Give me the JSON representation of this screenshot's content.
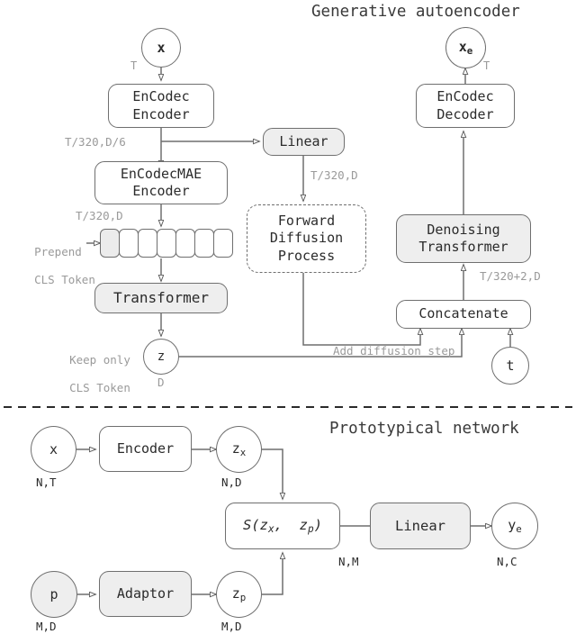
{
  "figure": {
    "sections": [
      {
        "id": "generative-autoencoder",
        "title": "Generative autoencoder"
      },
      {
        "id": "prototypical-network",
        "title": "Prototypical network"
      }
    ]
  },
  "generative": {
    "nodes": {
      "input_x": "x",
      "encodec_encoder": {
        "line1": "EnCodec",
        "line2": "Encoder"
      },
      "linear": "Linear",
      "encodecmae_encoder": {
        "line1": "EnCodecMAE",
        "line2": "Encoder"
      },
      "transformer": "Transformer",
      "latent_z": "z",
      "forward_diffusion": {
        "line1": "Forward",
        "line2": "Diffusion",
        "line3": "Process"
      },
      "denoising_transformer": {
        "line1": "Denoising",
        "line2": "Transformer"
      },
      "concatenate": "Concatenate",
      "timestep_t": "t",
      "encodec_decoder": {
        "line1": "EnCodec",
        "line2": "Decoder"
      },
      "output_xe": "x",
      "output_xe_sub": "e"
    },
    "edge_labels": {
      "x_to_encoder": "T",
      "encoder_out": "T/320,D/6",
      "linear_out": "T/320,D",
      "encodecmae_out": "T/320,D",
      "z_dim": "D",
      "concat_out": "T/320+2,D",
      "decoder_to_xe": "T"
    },
    "annotations": {
      "prepend_cls": {
        "line1": "Prepend",
        "line2": "CLS Token"
      },
      "keep_cls": {
        "line1": "Keep only",
        "line2": "CLS Token"
      },
      "add_diffusion_step": "Add diffusion step"
    },
    "token_row": {
      "count": 7,
      "cls_index": 0
    }
  },
  "prototypical": {
    "nodes": {
      "input_x": "x",
      "encoder": "Encoder",
      "zx": "z",
      "zx_sub": "x",
      "similarity": "S(z",
      "similarity_sub1": "x",
      "similarity_mid": ",  z",
      "similarity_sub2": "p",
      "similarity_end": ")",
      "linear": "Linear",
      "ye": "y",
      "ye_sub": "e",
      "input_p": "p",
      "adaptor": "Adaptor",
      "zp": "z",
      "zp_sub": "p"
    },
    "edge_labels": {
      "x_dim": "N,T",
      "zx_dim": "N,D",
      "similarity_dim": "N,M",
      "ye_dim": "N,C",
      "p_dim": "M,D",
      "zp_dim": "M,D"
    }
  },
  "colors": {
    "stroke": "#6f6f6f",
    "fill_gray": "#eeeeee",
    "label_gray": "#9a9a9a",
    "text": "#2b2b2b",
    "background": "#ffffff"
  }
}
